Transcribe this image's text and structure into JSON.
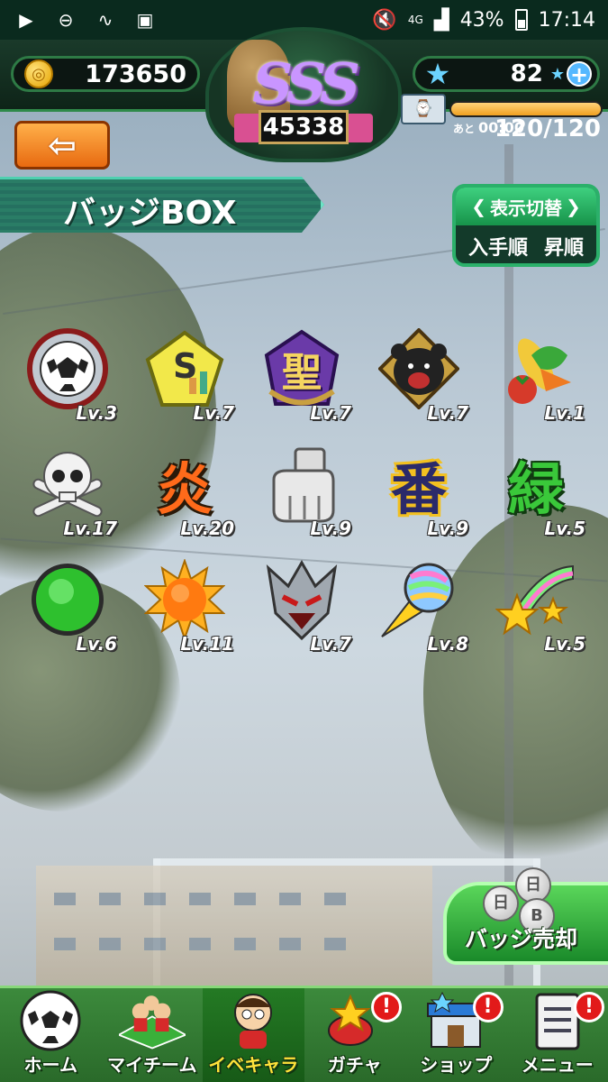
{
  "status_bar": {
    "network": "4G",
    "battery": "43%",
    "time": "17:14"
  },
  "header": {
    "coins": "173650",
    "rank": "SSS",
    "rank_score": "45338",
    "stars": "82",
    "plus": "+",
    "stamina_time_label": "あと",
    "stamina_time": "00:00",
    "stamina_count": "120/120",
    "stamina_fill": 1.0
  },
  "back_button": {
    "arrow": "⇦"
  },
  "title": "バッジBOX",
  "sort": {
    "header": "表示切替",
    "order_by": "入手順",
    "direction": "昇順"
  },
  "badges": [
    {
      "name": "soccer-ball-badge",
      "level": "Lv.3"
    },
    {
      "name": "money-chart-badge",
      "level": "Lv.7"
    },
    {
      "name": "holy-kanji-badge",
      "level": "Lv.7",
      "glyph": "聖"
    },
    {
      "name": "bear-badge",
      "level": "Lv.7"
    },
    {
      "name": "vegetables-badge",
      "level": "Lv.1"
    },
    {
      "name": "skull-badge",
      "level": "Lv.17"
    },
    {
      "name": "flame-kanji-badge",
      "level": "Lv.20",
      "glyph": "炎"
    },
    {
      "name": "gauntlet-badge",
      "level": "Lv.9"
    },
    {
      "name": "ban-kanji-badge",
      "level": "Lv.9",
      "glyph": "番"
    },
    {
      "name": "green-kanji-badge",
      "level": "Lv.5",
      "glyph": "緑"
    },
    {
      "name": "green-orb-badge",
      "level": "Lv.6"
    },
    {
      "name": "sun-badge",
      "level": "Lv.11"
    },
    {
      "name": "armor-mask-badge",
      "level": "Lv.7"
    },
    {
      "name": "rainbow-ball-badge",
      "level": "Lv.8"
    },
    {
      "name": "shooting-stars-badge",
      "level": "Lv.5"
    }
  ],
  "sell_button": {
    "label": "バッジ売却"
  },
  "nav": [
    {
      "label": "ホーム",
      "icon": "soccer-ball-icon",
      "alert": false
    },
    {
      "label": "マイチーム",
      "icon": "team-icon",
      "alert": false
    },
    {
      "label": "イベキャラ",
      "icon": "event-character-icon",
      "alert": false,
      "active": true
    },
    {
      "label": "ガチャ",
      "icon": "gacha-icon",
      "alert": true
    },
    {
      "label": "ショップ",
      "icon": "shop-icon",
      "alert": true
    },
    {
      "label": "メニュー",
      "icon": "menu-icon",
      "alert": true
    }
  ],
  "alert_mark": "!"
}
